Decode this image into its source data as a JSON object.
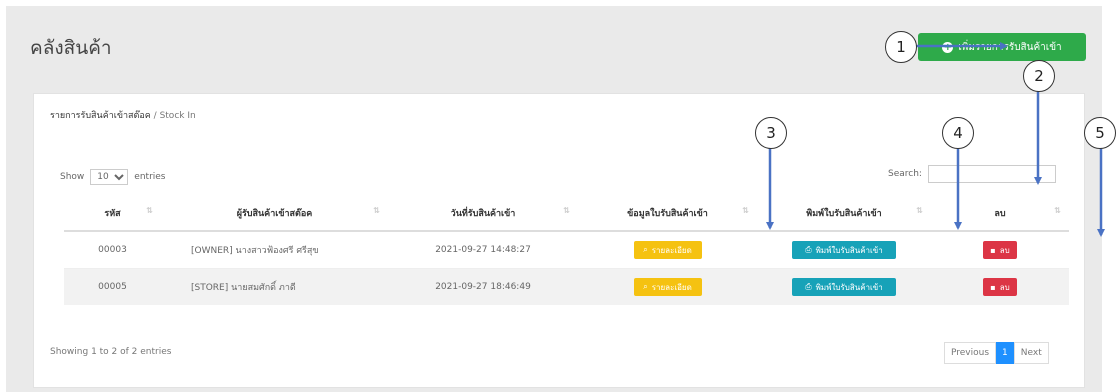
{
  "page": {
    "title": "คลังสินค้า"
  },
  "toolbar": {
    "add_button_label": "เพิ่มรายการรับสินค้าเข้า",
    "add_icon": "plus-circle-icon"
  },
  "breadcrumb": {
    "main": "รายการรับสินค้าเข้าสต๊อค",
    "sub": " / Stock In"
  },
  "length_control": {
    "prefix": "Show",
    "value": "10",
    "suffix": "entries"
  },
  "search": {
    "label": "Search:",
    "placeholder": ""
  },
  "table": {
    "headers": [
      "รหัส",
      "ผู้รับสินค้าเข้าสต๊อค",
      "วันที่รับสินค้าเข้า",
      "ข้อมูลใบรับสินค้าเข้า",
      "พิมพ์ใบรับสินค้าเข้า",
      "ลบ"
    ],
    "rows": [
      {
        "code": "00003",
        "receiver": "[OWNER] นางสาวฟ้องศรี  ศรีสุข",
        "date": "2021-09-27 14:48:27",
        "view_label": "รายละเอียด",
        "print_label": "พิมพ์ใบรับสินค้าเข้า",
        "delete_label": "ลบ"
      },
      {
        "code": "00005",
        "receiver": "[STORE] นายสมศักดิ์  ภาดี",
        "date": "2021-09-27 18:46:49",
        "view_label": "รายละเอียด",
        "print_label": "พิมพ์ใบรับสินค้าเข้า",
        "delete_label": "ลบ"
      }
    ]
  },
  "footer": {
    "info": "Showing 1 to 2 of 2 entries"
  },
  "pagination": {
    "previous": "Previous",
    "current": "1",
    "next": "Next"
  },
  "callouts": [
    "1",
    "2",
    "3",
    "4",
    "5"
  ],
  "colors": {
    "success": "#2eaa4a",
    "warning": "#f5c211",
    "info": "#17a2b8",
    "danger": "#dc3545",
    "primary": "#1e90ff",
    "arrow": "#4a72c4"
  }
}
